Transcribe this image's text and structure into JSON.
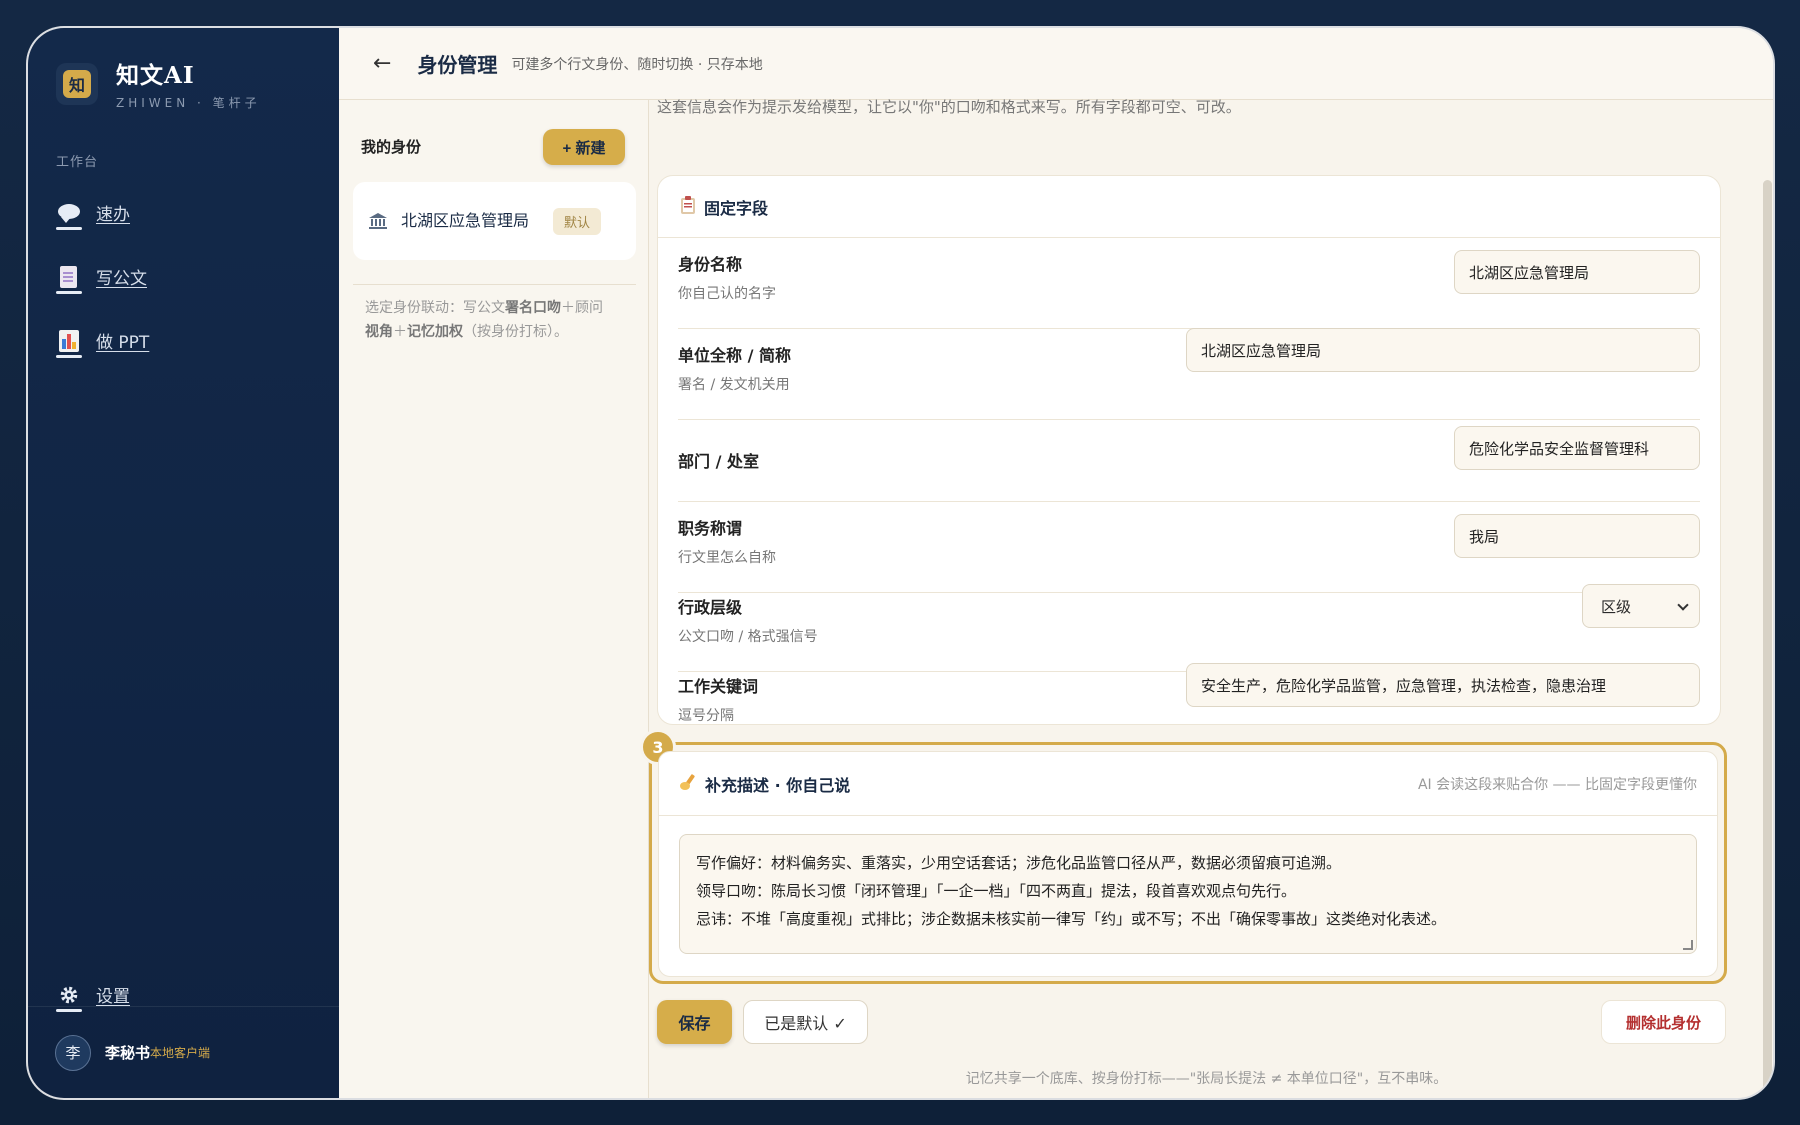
{
  "brand": {
    "title": "知文AI",
    "subtitle": "ZHIWEN · 笔杆子",
    "logo_char": "知"
  },
  "sidebar": {
    "section_label": "工作台",
    "items": [
      {
        "label": "速办",
        "icon": "speech-bubble-icon"
      },
      {
        "label": "写公文",
        "icon": "document-icon"
      },
      {
        "label": "做 PPT",
        "icon": "bar-chart-icon"
      }
    ],
    "settings_label": "设置"
  },
  "user": {
    "avatar_char": "李",
    "name": "李秘书",
    "tag": "本地客户端"
  },
  "header": {
    "back": "←",
    "title": "身份管理",
    "subtitle": "可建多个行文身份、随时切换 · 只存本地"
  },
  "identities": {
    "heading": "我的身份",
    "new_button": "+ 新建",
    "items": [
      {
        "name": "北湖区应急管理局",
        "badge": "默认"
      }
    ],
    "note_parts": [
      "选定身份联动：写公文",
      "署名口吻",
      "＋顾问",
      "视角",
      "＋",
      "记忆加权",
      "（按身份打标）。"
    ]
  },
  "form": {
    "intro": "这套信息会作为提示发给模型，让它以\"你\"的口吻和格式来写。所有字段都可空、可改。",
    "fixed_title": "固定字段",
    "fields": [
      {
        "label": "身份名称",
        "hint": "你自己认的名字",
        "value": "北湖区应急管理局"
      },
      {
        "label": "单位全称 / 简称",
        "hint": "署名 / 发文机关用",
        "value": "北湖区应急管理局"
      },
      {
        "label": "部门 / 处室",
        "hint": "",
        "value": "危险化学品安全监督管理科"
      },
      {
        "label": "职务称谓",
        "hint": "行文里怎么自称",
        "value": "我局"
      },
      {
        "label": "行政层级",
        "hint": "公文口吻 / 格式强信号",
        "value": "区级"
      },
      {
        "label": "工作关键词",
        "hint": "逗号分隔",
        "value": "安全生产，危险化学品监管，应急管理，执法检查，隐患治理"
      }
    ],
    "step_number": "3",
    "desc_title": "补充描述 · 你自己说",
    "desc_hint": "AI 会读这段来贴合你 —— 比固定字段更懂你",
    "desc_lines": [
      "写作偏好：材料偏务实、重落实，少用空话套话；涉危化品监管口径从严，数据必须留痕可追溯。",
      "领导口吻：陈局长习惯「闭环管理」「一企一档」「四不两直」提法，段首喜欢观点句先行。",
      "忌讳：不堆「高度重视」式排比；涉企数据未核实前一律写「约」或不写；不出「确保零事故」这类绝对化表述。"
    ]
  },
  "actions": {
    "save": "保存",
    "default": "已是默认 ✓",
    "delete": "删除此身份"
  },
  "footer_note": "记忆共享一个底库、按身份打标——\"张局长提法 ≠ 本单位口径\"，互不串味。",
  "colors": {
    "accent": "#d4aa4a",
    "sidebar_bg": "#13294a",
    "danger": "#b43030"
  }
}
